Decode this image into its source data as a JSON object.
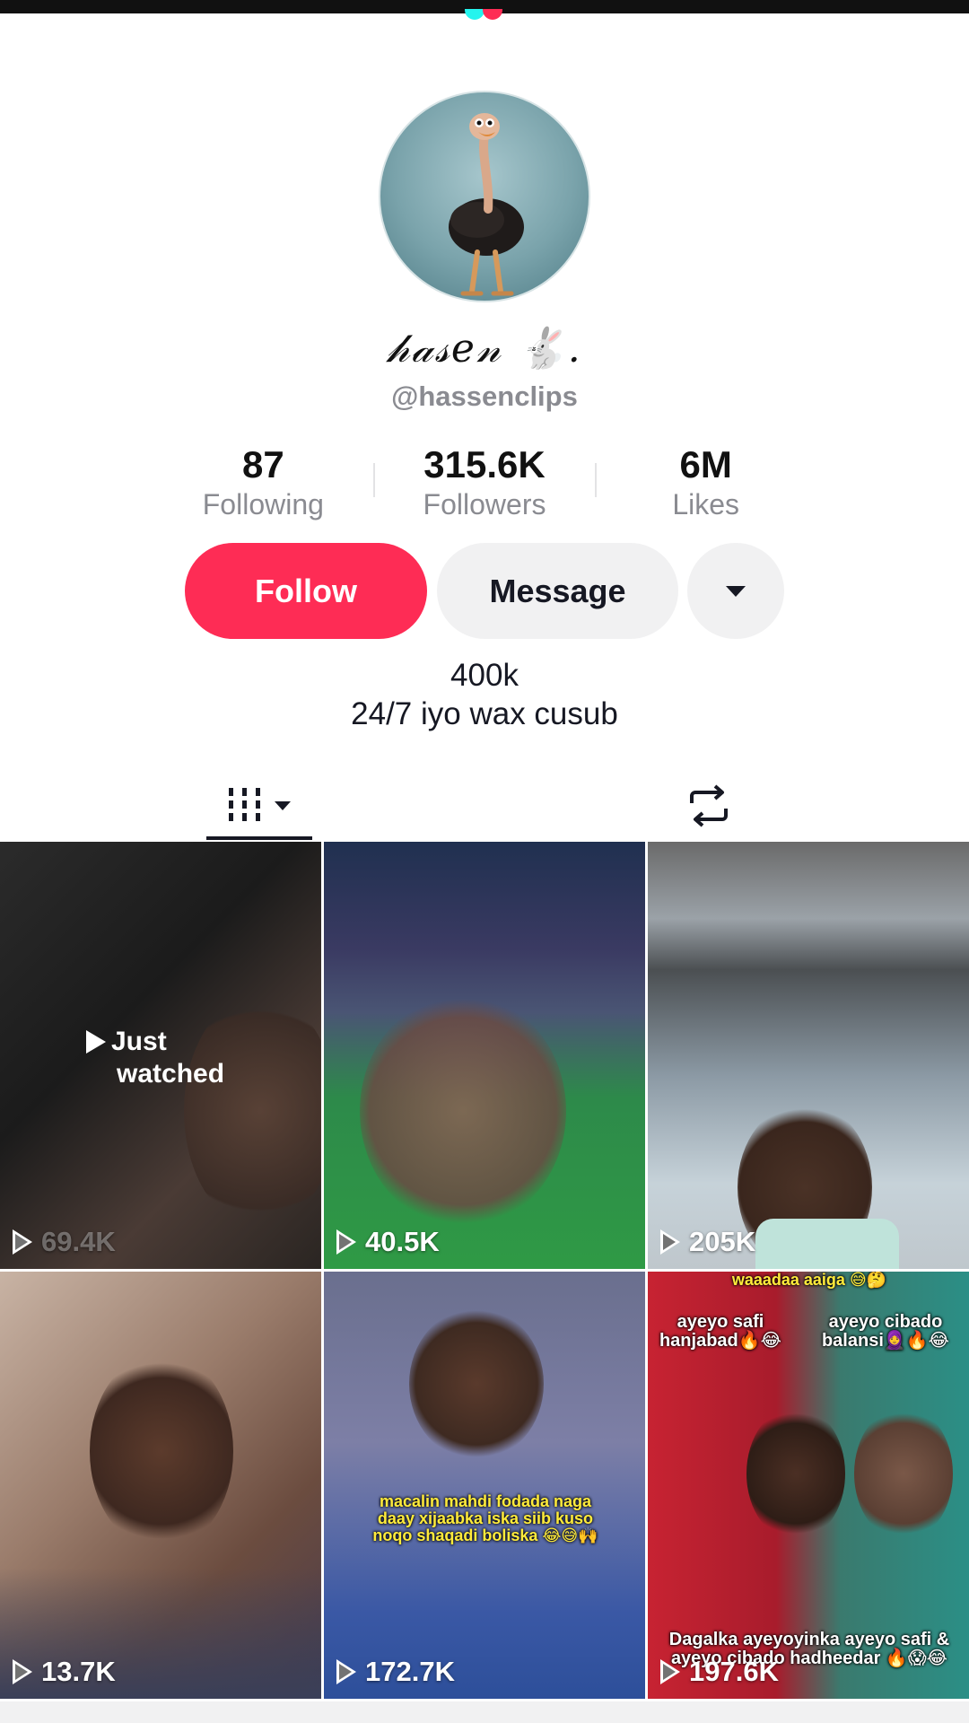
{
  "profile": {
    "display_name": "𝒽𝒶𝓈𝑒𝓃 🐇.",
    "handle": "@hassenclips",
    "stats": [
      {
        "num": "87",
        "label": "Following"
      },
      {
        "num": "315.6K",
        "label": "Followers"
      },
      {
        "num": "6M",
        "label": "Likes"
      }
    ],
    "bio_line1": "400k",
    "bio_line2": "24/7 iyo wax cusub"
  },
  "actions": {
    "follow_label": "Follow",
    "message_label": "Message",
    "more_icon": "caret-down-icon"
  },
  "tabs": {
    "videos_icon": "grid-icon",
    "reposts_icon": "repost-icon"
  },
  "colors": {
    "brand": "#fe2c55",
    "button_bg": "#f1f1f2",
    "secondary_text": "#8a8b91"
  },
  "videos": [
    {
      "views": "69.4K",
      "overlay": "Just",
      "overlay2": "watched"
    },
    {
      "views": "40.5K"
    },
    {
      "views": "205K"
    },
    {
      "views": "13.7K"
    },
    {
      "views": "172.7K",
      "caption": "macalin mahdi fodada naga daay xijaabka iska siib kuso noqo shaqadi boliska 😂😅🙌"
    },
    {
      "views": "197.6K",
      "caption_top": "waaadaa aaiga 😅🤔",
      "caption_left": "ayeyo safi hanjabad🔥😂",
      "caption_right": "ayeyo cibado balansi🧕🔥😂",
      "caption_bottom": "Dagalka ayeyoyinka ayeyo safi & ayeyo cibado hadheedar 🔥😱😂"
    }
  ]
}
